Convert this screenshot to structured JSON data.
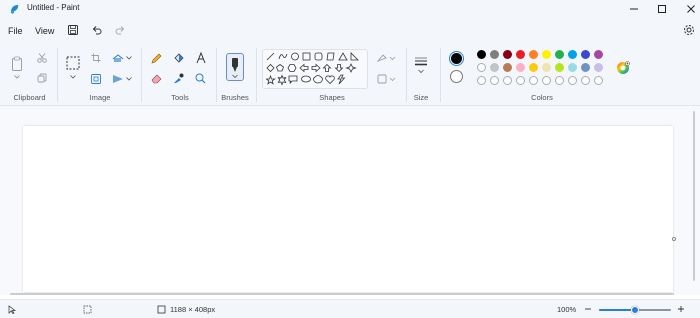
{
  "window": {
    "title": "Untitled - Paint",
    "minimize_icon": "minimize-icon",
    "maximize_icon": "maximize-icon",
    "close_icon": "close-icon"
  },
  "menu": {
    "file": "File",
    "view": "View",
    "settings_icon": "settings-icon"
  },
  "ribbon": {
    "groups": {
      "clipboard": "Clipboard",
      "image": "Image",
      "tools": "Tools",
      "brushes": "Brushes",
      "shapes": "Shapes",
      "size": "Size",
      "colors": "Colors"
    }
  },
  "colors": {
    "primary": "#000000",
    "secondary": "#ffffff",
    "row1": [
      "#000000",
      "#7f7f7f",
      "#880015",
      "#ed1c24",
      "#ff7f27",
      "#fff200",
      "#22b14c",
      "#00a2e8",
      "#3f48cc",
      "#a349a4"
    ],
    "row2": [
      "#ffffff",
      "#c3c3c3",
      "#b97a57",
      "#ffaec9",
      "#ffc90e",
      "#efe4b0",
      "#b5e61d",
      "#99d9ea",
      "#7092be",
      "#c8bfe7"
    ]
  },
  "status": {
    "canvas_size": "1188 × 408px",
    "zoom": "100%",
    "zoom_level": 0.5
  }
}
